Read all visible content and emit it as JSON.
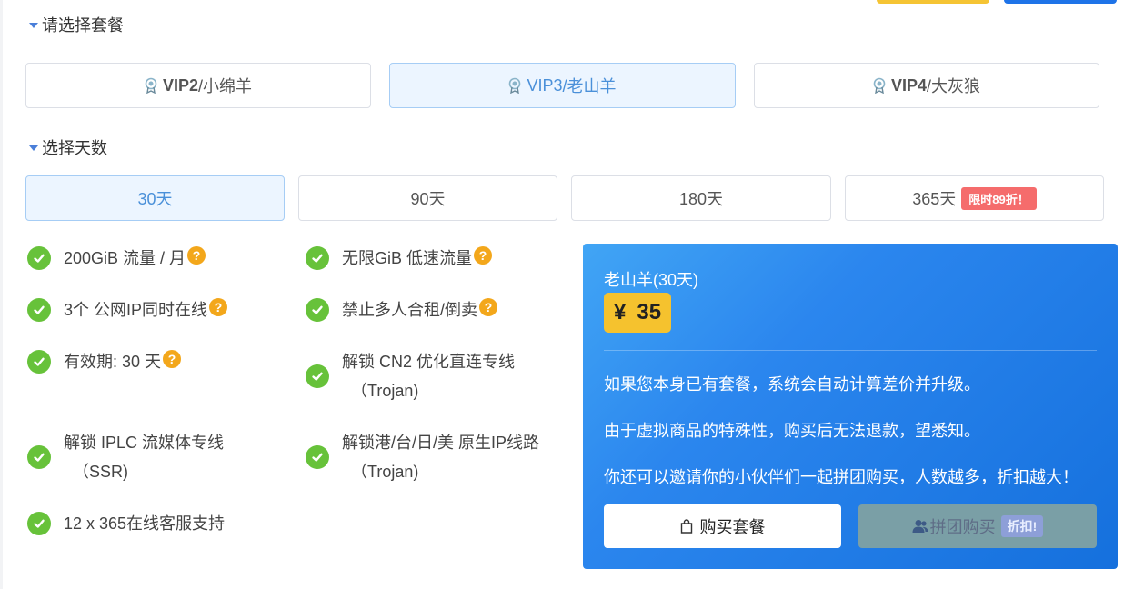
{
  "section_package": {
    "title": "请选择套餐"
  },
  "packages": [
    {
      "prefix": "VIP2",
      "suffix": "/小绵羊"
    },
    {
      "prefix": "VIP3",
      "suffix": "/老山羊"
    },
    {
      "prefix": "VIP4",
      "suffix": "/大灰狼"
    }
  ],
  "section_days": {
    "title": "选择天数"
  },
  "days": [
    {
      "label": "30天"
    },
    {
      "label": "90天"
    },
    {
      "label": "180天"
    },
    {
      "label": "365天",
      "badge": "限时89折！"
    }
  ],
  "features": {
    "f1": "200GiB 流量 / 月",
    "f2": "无限GiB 低速流量",
    "f3": "3个 公网IP同时在线",
    "f4": "禁止多人合租/倒卖",
    "f5": "有效期: 30 天",
    "f6_line1": "解锁 CN2 优化直连专线",
    "f6_line2": "（Trojan)",
    "f7_line1": "解锁 IPLC 流媒体专线",
    "f7_line2": "（SSR)",
    "f8_line1": "解锁港/台/日/美 原生IP线路",
    "f8_line2": "（Trojan)",
    "f9": "12 x 365在线客服支持",
    "help_mark": "?"
  },
  "panel": {
    "plan_name": "老山羊(30天)",
    "currency": "¥",
    "price": "35",
    "note1": "如果您本身已有套餐，系统会自动计算差价并升级。",
    "note2": "由于虚拟商品的特殊性，购买后无法退款，望悉知。",
    "note3": "你还可以邀请你的小伙伴们一起拼团购买，人数越多，折扣越大！",
    "buy_label": "购买套餐",
    "group_label": "拼团购买",
    "group_badge": "折扣!"
  },
  "colors": {
    "accent": "#4a90d9",
    "check": "#67c23a",
    "help": "#f3a71b",
    "price_bg": "#f5c22e",
    "limit_badge": "#f56c6c"
  }
}
